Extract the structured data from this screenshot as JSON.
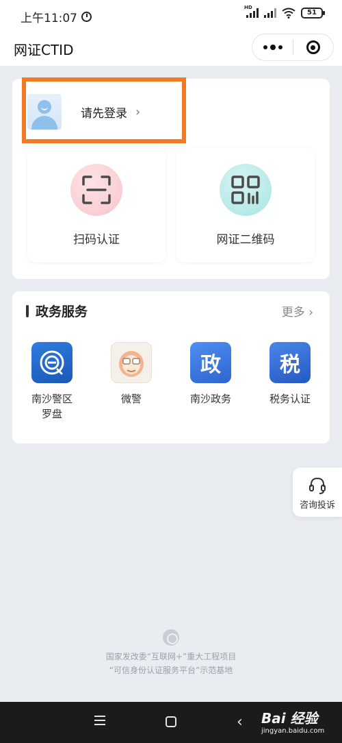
{
  "status_bar": {
    "time": "上午11:07",
    "battery": "51",
    "signal_tag": "HD"
  },
  "header": {
    "title": "网证CTID"
  },
  "login": {
    "label": "请先登录",
    "chevron": "›"
  },
  "quick_actions": [
    {
      "label": "扫码认证",
      "icon": "scan-frame-icon"
    },
    {
      "label": "网证二维码",
      "icon": "qr-code-icon"
    }
  ],
  "gov_services": {
    "title": "政务服务",
    "more": "更多 ›",
    "items": [
      {
        "label": "南沙警区\n罗盘",
        "icon": "police-compass-icon"
      },
      {
        "label": "微警",
        "icon": "weijing-icon"
      },
      {
        "label": "南沙政务",
        "icon": "gov-icon",
        "glyph": "政"
      },
      {
        "label": "税务认证",
        "icon": "tax-icon",
        "glyph": "税"
      }
    ]
  },
  "consult": {
    "label": "咨询投诉",
    "icon": "headset-icon"
  },
  "footer": {
    "line1": "国家发改委“互联网+”重大工程项目",
    "line2": "“可信身份认证服务平台”示范基地"
  },
  "watermark": {
    "brand": "Bai 经验",
    "url": "jingyan.baidu.com"
  },
  "colors": {
    "highlight": "#f37a25",
    "accent": "#2d66cf"
  }
}
